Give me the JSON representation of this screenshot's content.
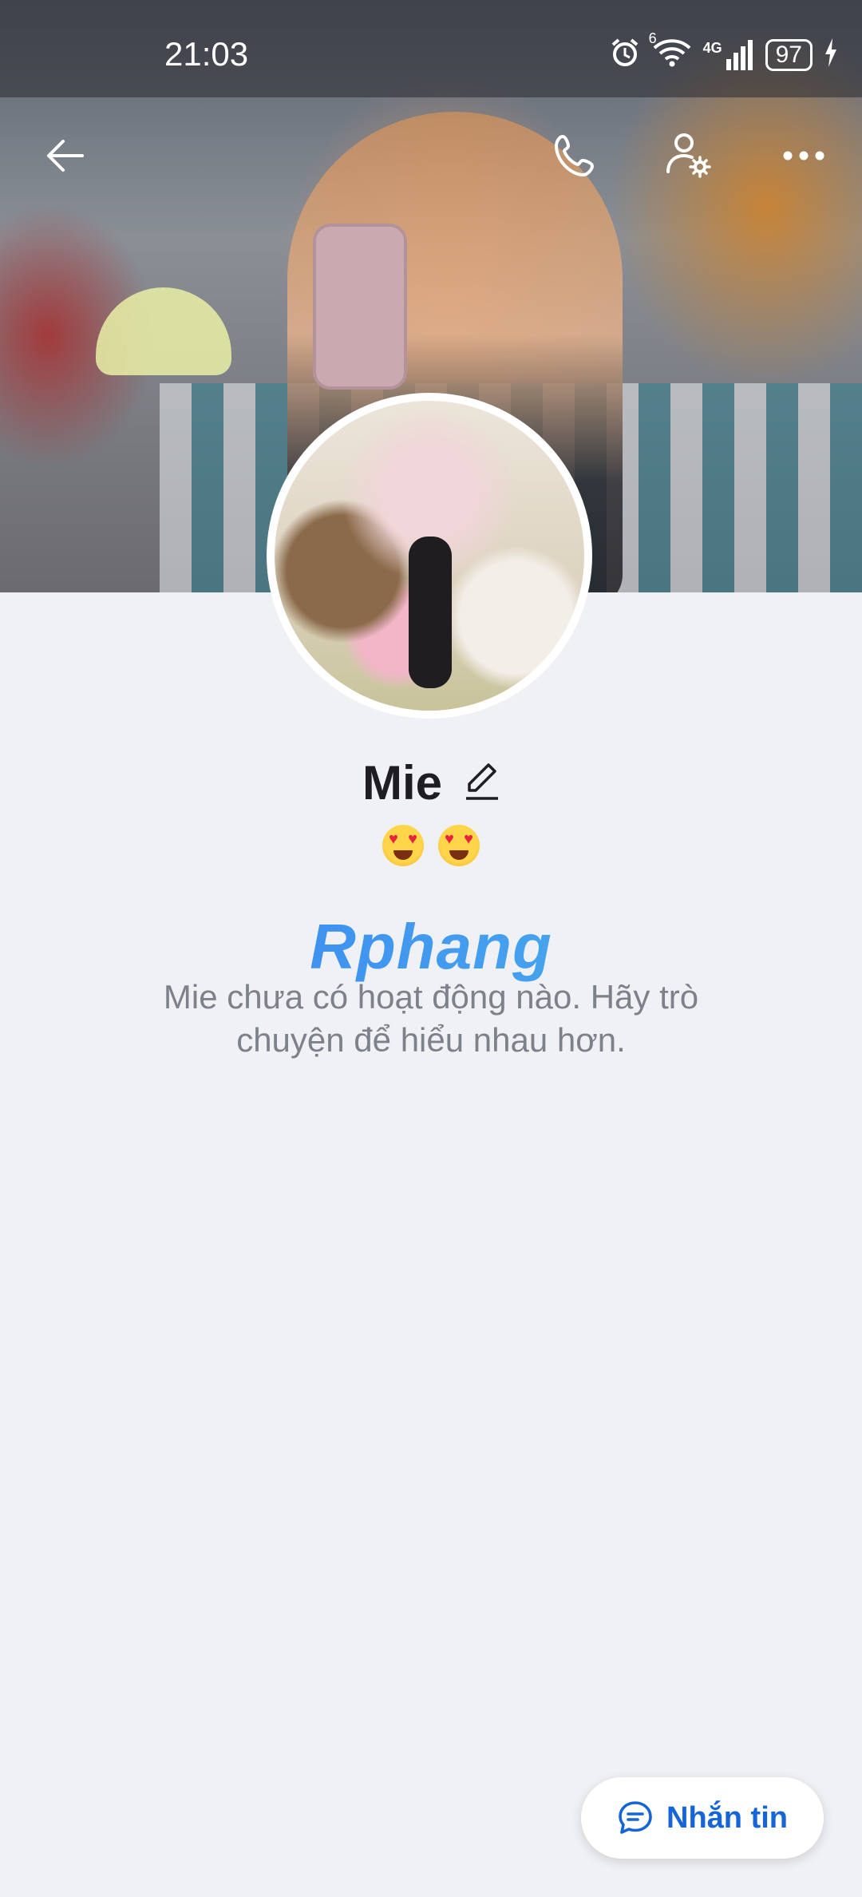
{
  "status_bar": {
    "time": "21:03",
    "wifi_badge": "6",
    "network": "4G",
    "battery": "97"
  },
  "toolbar": {
    "back_icon": "arrow-left-icon",
    "call_icon": "phone-icon",
    "settings_icon": "user-settings-icon",
    "more_icon": "more-horizontal-icon"
  },
  "profile": {
    "name": "Mie",
    "edit_icon": "pencil-icon",
    "status_emoji": "😍😍"
  },
  "watermark": "Rphang",
  "empty_state": {
    "message": "Mie chưa có hoạt động nào. Hãy trò chuyện để hiểu nhau hơn."
  },
  "fab": {
    "label": "Nhắn tin",
    "icon": "chat-bubble-icon"
  },
  "colors": {
    "accent": "#1565d8",
    "background": "#f0f1f5",
    "text_secondary": "#7d818b"
  }
}
